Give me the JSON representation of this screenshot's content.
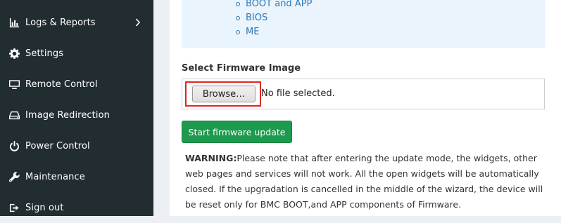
{
  "sidebar": {
    "items": [
      {
        "label": "Logs & Reports",
        "icon": "bar-chart-icon",
        "has_submenu": true
      },
      {
        "label": "Settings",
        "icon": "gear-icon",
        "has_submenu": false
      },
      {
        "label": "Remote Control",
        "icon": "monitor-icon",
        "has_submenu": false
      },
      {
        "label": "Image Redirection",
        "icon": "drive-icon",
        "has_submenu": false
      },
      {
        "label": "Power Control",
        "icon": "power-icon",
        "has_submenu": false
      },
      {
        "label": "Maintenance",
        "icon": "wrench-icon",
        "has_submenu": false
      },
      {
        "label": "Sign out",
        "icon": "sign-out-icon",
        "has_submenu": false
      }
    ]
  },
  "info": {
    "items": [
      "BOOT and APP",
      "BIOS",
      "ME"
    ]
  },
  "firmware": {
    "section_label": "Select Firmware Image",
    "browse_label": "Browse…",
    "file_status": "No file selected.",
    "update_button": "Start firmware update"
  },
  "warning": {
    "prefix": "WARNING:",
    "text": "Please note that after entering the update mode, the widgets, other web pages and services will not work. All the open widgets will be automatically closed. If the upgradation is cancelled in the middle of the wizard, the device will be reset only for BMC BOOT,and APP components of Firmware."
  },
  "colors": {
    "sidebar_bg": "#222d32",
    "accent_green": "#1e9a4e",
    "highlight_red": "#e0281e",
    "link_blue": "#2d78b7"
  }
}
